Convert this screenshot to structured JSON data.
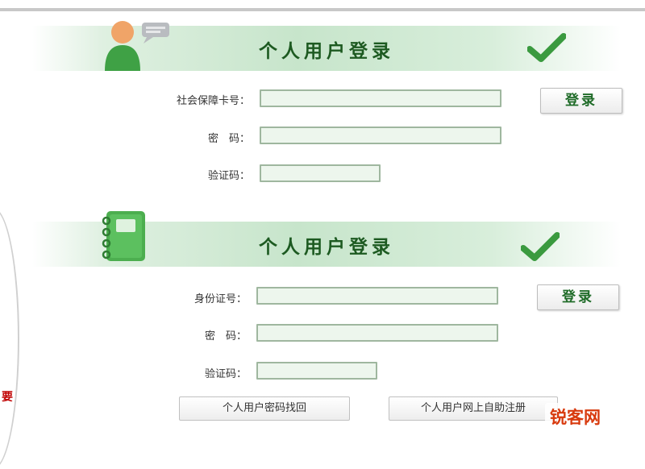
{
  "edge_text": "要",
  "section1": {
    "title": "个人用户登录",
    "fields": [
      {
        "label": "社会保障卡号：",
        "value": ""
      },
      {
        "label": "密　码：",
        "value": ""
      },
      {
        "label": "验证码：",
        "value": ""
      }
    ],
    "login_label": "登录"
  },
  "section2": {
    "title": "个人用户登录",
    "fields": [
      {
        "label": "身份证号：",
        "value": ""
      },
      {
        "label": "密　码：",
        "value": ""
      },
      {
        "label": "验证码：",
        "value": ""
      }
    ],
    "login_label": "登录"
  },
  "links": {
    "recover_password": "个人用户密码找回",
    "online_register": "个人用户网上自助注册"
  },
  "watermark": "锐客网",
  "colors": {
    "accent_green": "#3a9a3f",
    "title_green": "#1d5a21",
    "watermark_red": "#d83a0e"
  },
  "icons": {
    "user": "user-chat-icon",
    "book": "notebook-icon",
    "check": "check-icon"
  }
}
